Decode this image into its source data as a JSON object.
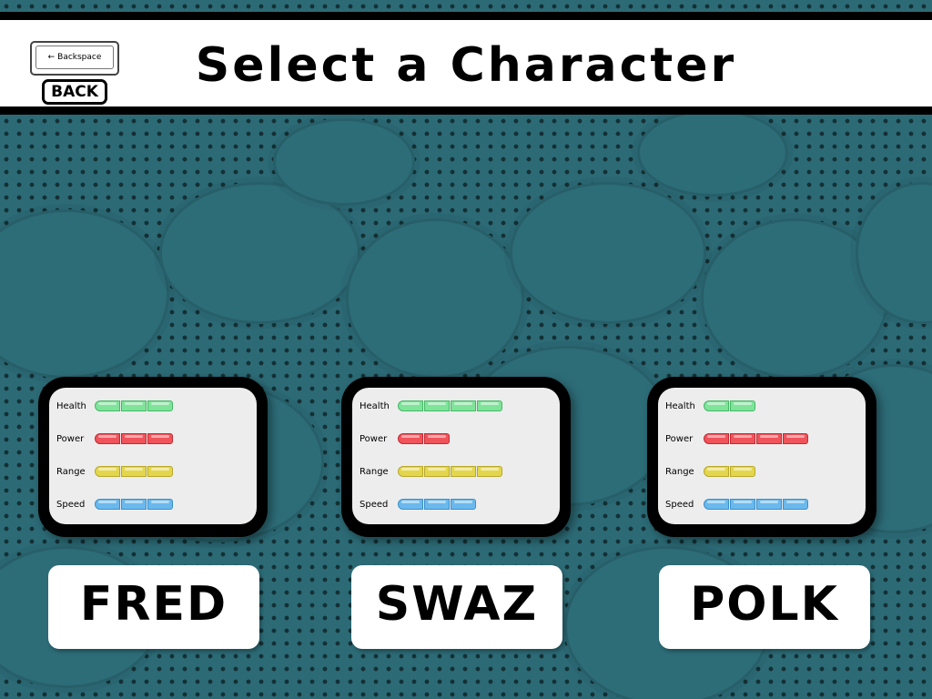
{
  "title": "Select a Character",
  "back": {
    "key_label": "Backspace",
    "button_label": "BACK"
  },
  "colors": {
    "health": "#7fe39a",
    "power": "#f0535a",
    "range": "#e4d64c",
    "speed": "#6bb8ec",
    "background": "#2c6b76"
  },
  "stat_labels": [
    "Health",
    "Power",
    "Range",
    "Speed"
  ],
  "characters": [
    {
      "name": "FRED",
      "stats": {
        "Health": 3,
        "Power": 3,
        "Range": 3,
        "Speed": 3
      }
    },
    {
      "name": "SWAZ",
      "stats": {
        "Health": 4,
        "Power": 2,
        "Range": 4,
        "Speed": 3
      }
    },
    {
      "name": "POLK",
      "stats": {
        "Health": 2,
        "Power": 4,
        "Range": 2,
        "Speed": 4
      }
    }
  ]
}
